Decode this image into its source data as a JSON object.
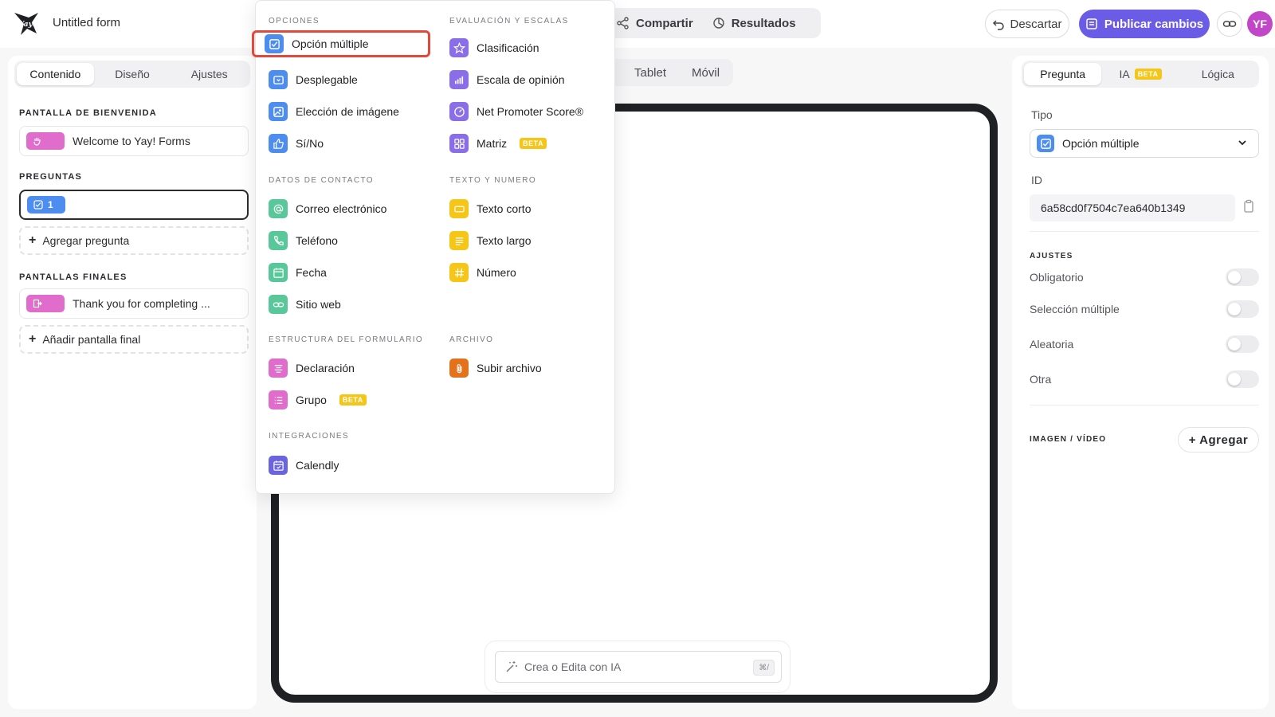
{
  "header": {
    "logo_text": "Yay!",
    "form_title": "Untitled form",
    "share_label": "Compartir",
    "results_label": "Resultados",
    "discard_label": "Descartar",
    "publish_label": "Publicar cambios",
    "avatar_initials": "YF"
  },
  "left": {
    "tabs": [
      "Contenido",
      "Diseño",
      "Ajustes"
    ],
    "welcome_section": "PANTALLA DE BIENVENIDA",
    "welcome_item": "Welcome to Yay! Forms",
    "questions_section": "PREGUNTAS",
    "question_number": "1",
    "add_question": "Agregar pregunta",
    "endings_section": "PANTALLAS FINALES",
    "ending_item": "Thank you for completing ...",
    "add_ending": "Añadir pantalla final"
  },
  "center": {
    "device_tabs": [
      "Tablet",
      "Móvil"
    ],
    "ai_placeholder": "Crea o Edita con IA",
    "ai_shortcut": "⌘/"
  },
  "right": {
    "tabs": [
      "Pregunta",
      "IA",
      "Lógica"
    ],
    "beta": "BETA",
    "type_label": "Tipo",
    "type_value": "Opción múltiple",
    "id_label": "ID",
    "id_value": "6a58cd0f7504c7ea640b1349",
    "settings_section": "AJUSTES",
    "toggles": [
      "Obligatorio",
      "Selección múltiple",
      "Aleatoria",
      "Otra"
    ],
    "media_section": "IMAGEN / VÍDEO",
    "add_media": "+ Agregar"
  },
  "dropdown": {
    "beta": "BETA",
    "sections": {
      "opciones": "OPCIONES",
      "evaluacion": "EVALUACIÓN Y ESCALAS",
      "contacto": "DATOS DE CONTACTO",
      "texto": "TEXTO Y NUMERO",
      "estructura": "ESTRUCTURA DEL FORMULARIO",
      "archivo": "ARCHIVO",
      "integraciones": "INTEGRACIONES"
    },
    "items": {
      "opcion_multiple": "Opción múltiple",
      "desplegable": "Desplegable",
      "eleccion_imagen": "Elección de imágene",
      "si_no": "Sí/No",
      "clasificacion": "Clasificación",
      "escala_opinion": "Escala de opinión",
      "nps": "Net Promoter Score®",
      "matriz": "Matriz",
      "correo": "Correo electrónico",
      "telefono": "Teléfono",
      "fecha": "Fecha",
      "sitio_web": "Sitio web",
      "texto_corto": "Texto corto",
      "texto_largo": "Texto largo",
      "numero": "Número",
      "declaracion": "Declaración",
      "grupo": "Grupo",
      "subir_archivo": "Subir archivo",
      "calendly": "Calendly"
    }
  }
}
